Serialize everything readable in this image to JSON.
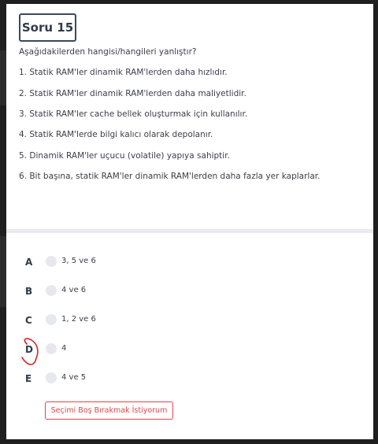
{
  "question": {
    "title": "Soru 15",
    "prompt": "Aşağıdakilerden hangisi/hangileri yanlıştır?",
    "statements": [
      "1. Statik RAM'ler dinamik RAM'lerden daha hızlıdır.",
      "2. Statik RAM'ler dinamik RAM'lerden daha maliyetlidir.",
      "3. Statik RAM'ler cache bellek oluşturmak için kullanılır.",
      "4. Statik RAM'lerde bilgi kalıcı olarak depolanır.",
      "5. Dinamik RAM'ler uçucu (volatile) yapıya sahiptir.",
      "6. Bit başına, statik RAM'ler dinamik RAM'lerden daha fazla yer kaplarlar."
    ]
  },
  "options": [
    {
      "letter": "A",
      "text": "3, 5 ve 6"
    },
    {
      "letter": "B",
      "text": "4 ve 6"
    },
    {
      "letter": "C",
      "text": "1, 2 ve 6"
    },
    {
      "letter": "D",
      "text": "4"
    },
    {
      "letter": "E",
      "text": "4 ve 5"
    }
  ],
  "skip_label": "Seçimi Boş Bırakmak İstiyorum",
  "colors": {
    "accent": "#e0454b",
    "title_border": "#3a4a5a",
    "annotation": "#e02020"
  }
}
